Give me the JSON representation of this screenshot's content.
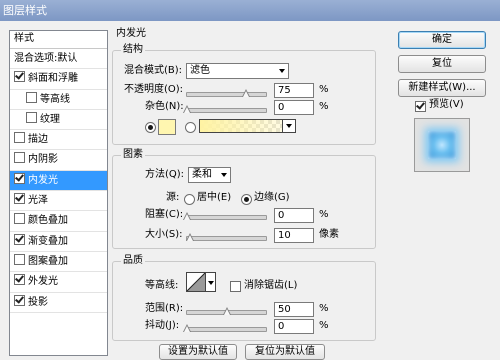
{
  "window": {
    "title": "图层样式"
  },
  "left_panel": {
    "header": "样式",
    "items": [
      {
        "label": "混合选项:默认",
        "checkbox": false,
        "checked": false,
        "indent": false,
        "selected": false
      },
      {
        "label": "斜面和浮雕",
        "checkbox": true,
        "checked": true,
        "indent": false,
        "selected": false
      },
      {
        "label": "等高线",
        "checkbox": true,
        "checked": false,
        "indent": true,
        "selected": false
      },
      {
        "label": "纹理",
        "checkbox": true,
        "checked": false,
        "indent": true,
        "selected": false
      },
      {
        "label": "描边",
        "checkbox": true,
        "checked": false,
        "indent": false,
        "selected": false
      },
      {
        "label": "内阴影",
        "checkbox": true,
        "checked": false,
        "indent": false,
        "selected": false
      },
      {
        "label": "内发光",
        "checkbox": true,
        "checked": true,
        "indent": false,
        "selected": true
      },
      {
        "label": "光泽",
        "checkbox": true,
        "checked": true,
        "indent": false,
        "selected": false
      },
      {
        "label": "颜色叠加",
        "checkbox": true,
        "checked": false,
        "indent": false,
        "selected": false
      },
      {
        "label": "渐变叠加",
        "checkbox": true,
        "checked": true,
        "indent": false,
        "selected": false
      },
      {
        "label": "图案叠加",
        "checkbox": true,
        "checked": false,
        "indent": false,
        "selected": false
      },
      {
        "label": "外发光",
        "checkbox": true,
        "checked": true,
        "indent": false,
        "selected": false
      },
      {
        "label": "投影",
        "checkbox": true,
        "checked": true,
        "indent": false,
        "selected": false
      }
    ]
  },
  "section_title": "内发光",
  "structure": {
    "title": "结构",
    "blend_mode_label": "混合模式(B):",
    "blend_mode_value": "滤色",
    "opacity_label": "不透明度(O):",
    "opacity_value": "75",
    "opacity_unit": "%",
    "noise_label": "杂色(N):",
    "noise_value": "0",
    "noise_unit": "%"
  },
  "elements": {
    "title": "图素",
    "method_label": "方法(Q):",
    "method_value": "柔和",
    "source_label": "源:",
    "center_label": "居中(E)",
    "edge_label": "边缘(G)",
    "choke_label": "阻塞(C):",
    "choke_value": "0",
    "choke_unit": "%",
    "size_label": "大小(S):",
    "size_value": "10",
    "size_unit": "像素"
  },
  "quality": {
    "title": "品质",
    "contour_label": "等高线:",
    "antialias_label": "消除锯齿(L)",
    "range_label": "范围(R):",
    "range_value": "50",
    "range_unit": "%",
    "jitter_label": "抖动(J):",
    "jitter_value": "0",
    "jitter_unit": "%"
  },
  "bottom_buttons": {
    "make_default": "设置为默认值",
    "reset_default": "复位为默认值"
  },
  "side_buttons": {
    "ok": "确定",
    "reset": "复位",
    "new_style": "新建样式(W)...",
    "preview": "预览(V)"
  },
  "colors": {
    "selection": "#3399ff",
    "glow_swatch": "#fff6b0",
    "preview_glow": "#3ea6ea"
  }
}
